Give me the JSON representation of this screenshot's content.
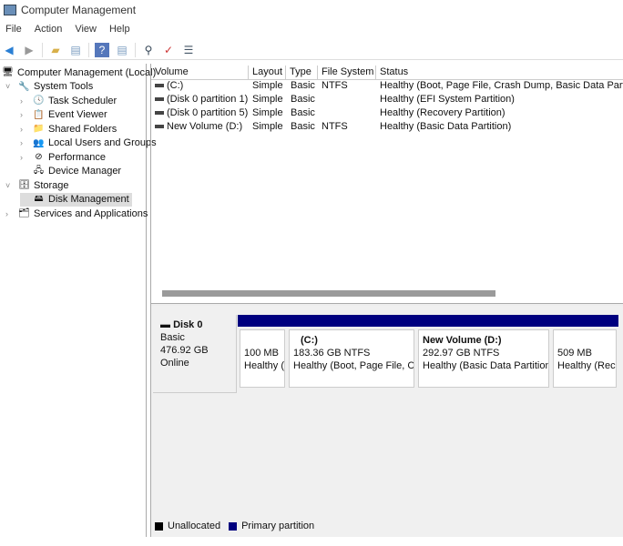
{
  "window": {
    "title": "Computer Management"
  },
  "menu": [
    "File",
    "Action",
    "View",
    "Help"
  ],
  "toolbar": [
    "back-icon",
    "forward-icon",
    "up-folder-icon",
    "show-hide-tree-icon",
    "help-icon",
    "properties-icon",
    "connect-icon",
    "check-icon",
    "list-icon"
  ],
  "tree": [
    {
      "label": "Computer Management (Local)",
      "level": 0,
      "expander": ""
    },
    {
      "label": "System Tools",
      "level": 1,
      "expander": "˅"
    },
    {
      "label": "Task Scheduler",
      "level": 2,
      "expander": "›"
    },
    {
      "label": "Event Viewer",
      "level": 2,
      "expander": "›"
    },
    {
      "label": "Shared Folders",
      "level": 2,
      "expander": "›"
    },
    {
      "label": "Local Users and Groups",
      "level": 2,
      "expander": "›"
    },
    {
      "label": "Performance",
      "level": 2,
      "expander": "›"
    },
    {
      "label": "Device Manager",
      "level": 2,
      "expander": ""
    },
    {
      "label": "Storage",
      "level": 1,
      "expander": "˅"
    },
    {
      "label": "Disk Management",
      "level": 2,
      "expander": "",
      "selected": true
    },
    {
      "label": "Services and Applications",
      "level": 1,
      "expander": "›"
    }
  ],
  "columns": [
    "Volume",
    "Layout",
    "Type",
    "File System",
    "Status"
  ],
  "volumes": [
    {
      "volume": "(C:)",
      "layout": "Simple",
      "type": "Basic",
      "fs": "NTFS",
      "status": "Healthy (Boot, Page File, Crash Dump, Basic Data Partition)"
    },
    {
      "volume": "(Disk 0 partition 1)",
      "layout": "Simple",
      "type": "Basic",
      "fs": "",
      "status": "Healthy (EFI System Partition)"
    },
    {
      "volume": "(Disk 0 partition 5)",
      "layout": "Simple",
      "type": "Basic",
      "fs": "",
      "status": "Healthy (Recovery Partition)"
    },
    {
      "volume": "New Volume (D:)",
      "layout": "Simple",
      "type": "Basic",
      "fs": "NTFS",
      "status": "Healthy (Basic Data Partition)"
    }
  ],
  "disk": {
    "name": "Disk 0",
    "type": "Basic",
    "size": "476.92 GB",
    "state": "Online"
  },
  "partitions": [
    {
      "title": "",
      "size": "100 MB",
      "status": "Healthy (EFI System Partition)"
    },
    {
      "title": "(C:)",
      "size": "183.36 GB NTFS",
      "status": "Healthy (Boot, Page File, Crash Dump, Basic Data Partition)"
    },
    {
      "title": "New Volume  (D:)",
      "size": "292.97 GB NTFS",
      "status": "Healthy (Basic Data Partition)"
    },
    {
      "title": "",
      "size": "509 MB",
      "status": "Healthy (Recovery Partition)"
    }
  ],
  "legend": [
    {
      "label": "Unallocated",
      "color": "#000000"
    },
    {
      "label": "Primary partition",
      "color": "#00007f"
    }
  ]
}
